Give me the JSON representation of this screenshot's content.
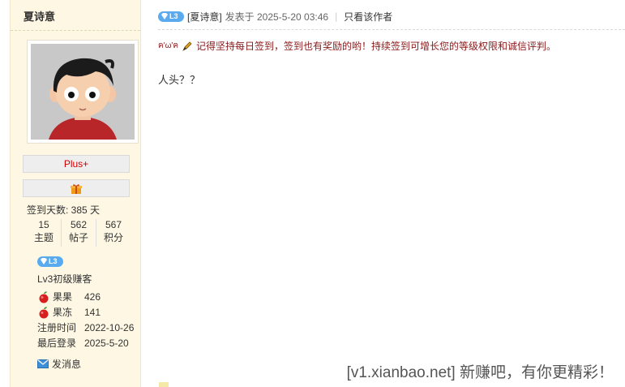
{
  "sidebar": {
    "username": "夏诗意",
    "plus_label": "Plus+",
    "checkin_text": "签到天数: 385 天",
    "stats": [
      {
        "value": "15",
        "label": "主题"
      },
      {
        "value": "562",
        "label": "帖子"
      },
      {
        "value": "567",
        "label": "积分"
      }
    ],
    "level_badge": "L3",
    "level_text": "Lv3初级赚客",
    "info": [
      {
        "key": "果果",
        "value": "426",
        "icon": "apple-icon"
      },
      {
        "key": "果冻",
        "value": "141",
        "icon": "apple-icon"
      },
      {
        "key": "注册时间",
        "value": "2022-10-26"
      },
      {
        "key": "最后登录",
        "value": "2025-5-20"
      }
    ],
    "message_label": "发消息"
  },
  "post": {
    "level_badge": "L3",
    "author": "[夏诗意]",
    "posted_at": "发表于 2025-5-20 03:46",
    "only_author": "只看该作者",
    "notice_emoticon": "ฅ'ω'ฅ",
    "notice_text": "记得坚持每日签到，签到也有奖励的哟！持续签到可增长您的等级权限和诚信评判。",
    "content": "人头？？"
  },
  "watermark": "[v1.xianbao.net] 新赚吧，有你更精彩！",
  "colors": {
    "sidebar_bg": "#fdf7e3",
    "badge_blue": "#5aaaf0",
    "notice_red": "#8b1a1a",
    "plus_red": "#cc0000"
  }
}
